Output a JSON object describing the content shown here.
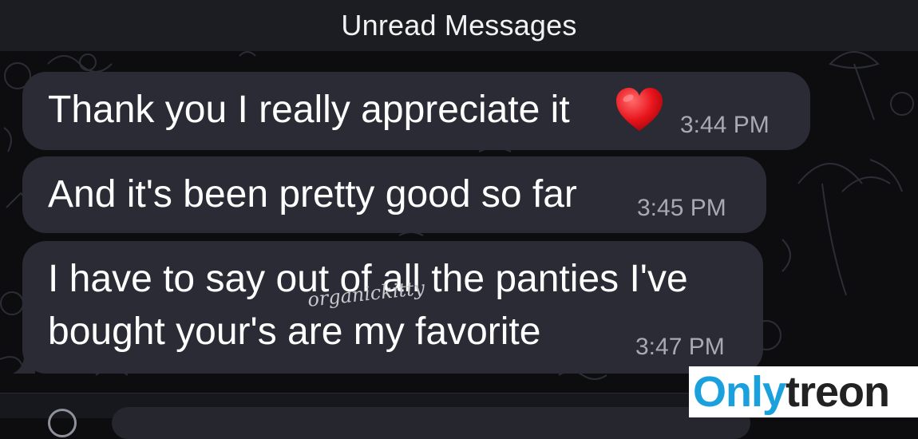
{
  "banner": {
    "title": "Unread Messages"
  },
  "messages": [
    {
      "text": "Thank you I really appreciate it",
      "emoji": "heart",
      "time": "3:44 PM"
    },
    {
      "text": "And it's been pretty good so far",
      "time": "3:45 PM"
    },
    {
      "line1": "I have to say out of all the panties I've",
      "line2": "bought your's are my favorite",
      "time": "3:47 PM"
    }
  ],
  "watermark": "organickitty",
  "logo": {
    "part1": "Only",
    "part2": "treon"
  },
  "colors": {
    "background": "#0d0d10",
    "bubble": "#2a2b35",
    "banner": "#1c1d23",
    "time": "#a7a9b4",
    "logo_blue": "#1aa0dc"
  },
  "icons": [
    "heart-emoji-icon",
    "attachment-icon"
  ]
}
